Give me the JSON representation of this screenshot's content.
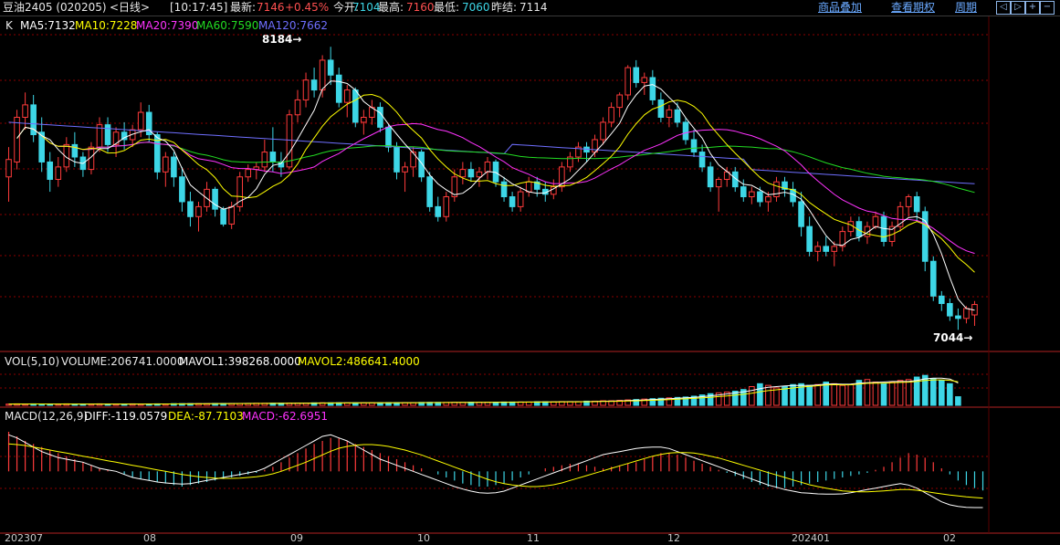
{
  "header": {
    "symbol": "豆油2405 (020205)",
    "period": "<日线>",
    "time": "[10:17:45]",
    "last_label": "最新:",
    "last_value": "7146",
    "change": "+0.45%",
    "open_label": "今开:",
    "open_value": "7104",
    "high_label": "最高:",
    "high_value": "7160",
    "low_label": "最低:",
    "low_value": "7060",
    "prev_label": "昨结:",
    "prev_value": "7114",
    "links": [
      "商品叠加",
      "查看期权",
      "周期"
    ]
  },
  "ma_legend": {
    "k": "K",
    "ma5": "MA5:7132",
    "ma10": "MA10:7228",
    "ma20": "MA20:7390",
    "ma60": "MA60:7590",
    "ma120": "MA120:7662"
  },
  "annotations": {
    "high": "8184",
    "low": "7044"
  },
  "vol_legend": {
    "name": "VOL(5,10)",
    "volume": "VOLUME:206741.0000",
    "mavol1": "MAVOL1:398268.0000",
    "mavol2": "MAVOL2:486641.4000"
  },
  "macd_legend": {
    "name": "MACD(12,26,9)",
    "diff": "DIFF:-119.0579",
    "dea": "DEA:-87.7103",
    "macd": "MACD:-62.6951"
  },
  "colors": {
    "up": "#ff3b3b",
    "down": "#3dd6e6",
    "ma5": "#ffffff",
    "ma10": "#ffff00",
    "ma20": "#ff33ff",
    "ma60": "#22dd22",
    "ma120": "#6f6fff",
    "grid": "#8b0000",
    "axis_text": "#c8c8c8",
    "up_text": "#ff5050",
    "green_text": "#22dd22",
    "cyan_text": "#3dd6e6"
  },
  "chart_data": {
    "type": "candlestick",
    "x_axis_labels": [
      "202307",
      "08",
      "09",
      "10",
      "11",
      "12",
      "202401",
      "02"
    ],
    "y_range": [
      6990,
      8240
    ],
    "candles": [
      [
        7660,
        7780,
        7560,
        7730
      ],
      [
        7720,
        7930,
        7690,
        7900
      ],
      [
        7900,
        8000,
        7850,
        7950
      ],
      [
        7950,
        7990,
        7800,
        7830
      ],
      [
        7840,
        7900,
        7680,
        7720
      ],
      [
        7720,
        7760,
        7600,
        7650
      ],
      [
        7650,
        7740,
        7620,
        7700
      ],
      [
        7700,
        7820,
        7680,
        7790
      ],
      [
        7790,
        7840,
        7700,
        7740
      ],
      [
        7740,
        7760,
        7660,
        7690
      ],
      [
        7690,
        7800,
        7670,
        7780
      ],
      [
        7780,
        7900,
        7760,
        7870
      ],
      [
        7870,
        7900,
        7760,
        7790
      ],
      [
        7790,
        7860,
        7740,
        7840
      ],
      [
        7840,
        7880,
        7770,
        7810
      ],
      [
        7810,
        7870,
        7780,
        7850
      ],
      [
        7850,
        7960,
        7820,
        7920
      ],
      [
        7920,
        7950,
        7800,
        7830
      ],
      [
        7830,
        7840,
        7650,
        7680
      ],
      [
        7680,
        7760,
        7620,
        7740
      ],
      [
        7740,
        7760,
        7620,
        7660
      ],
      [
        7660,
        7700,
        7520,
        7560
      ],
      [
        7560,
        7600,
        7460,
        7500
      ],
      [
        7500,
        7560,
        7440,
        7540
      ],
      [
        7540,
        7640,
        7520,
        7610
      ],
      [
        7610,
        7620,
        7500,
        7530
      ],
      [
        7530,
        7540,
        7460,
        7470
      ],
      [
        7470,
        7560,
        7450,
        7540
      ],
      [
        7540,
        7680,
        7520,
        7660
      ],
      [
        7660,
        7710,
        7640,
        7690
      ],
      [
        7690,
        7720,
        7650,
        7700
      ],
      [
        7700,
        7810,
        7680,
        7760
      ],
      [
        7760,
        7860,
        7680,
        7720
      ],
      [
        7720,
        7760,
        7660,
        7700
      ],
      [
        7700,
        7930,
        7690,
        7910
      ],
      [
        7910,
        8010,
        7880,
        7970
      ],
      [
        7970,
        8080,
        7940,
        8050
      ],
      [
        8050,
        8100,
        7980,
        8010
      ],
      [
        8010,
        8150,
        7980,
        8130
      ],
      [
        8130,
        8184,
        8030,
        8070
      ],
      [
        8070,
        8100,
        7940,
        7960
      ],
      [
        7960,
        8030,
        7900,
        8010
      ],
      [
        8010,
        8020,
        7860,
        7880
      ],
      [
        7880,
        7930,
        7830,
        7900
      ],
      [
        7900,
        7970,
        7870,
        7940
      ],
      [
        7940,
        7960,
        7840,
        7860
      ],
      [
        7860,
        7870,
        7760,
        7780
      ],
      [
        7780,
        7800,
        7650,
        7680
      ],
      [
        7680,
        7720,
        7600,
        7700
      ],
      [
        7700,
        7780,
        7660,
        7760
      ],
      [
        7760,
        7770,
        7640,
        7660
      ],
      [
        7660,
        7680,
        7520,
        7540
      ],
      [
        7540,
        7580,
        7480,
        7500
      ],
      [
        7500,
        7600,
        7480,
        7580
      ],
      [
        7580,
        7690,
        7560,
        7660
      ],
      [
        7660,
        7720,
        7630,
        7690
      ],
      [
        7690,
        7720,
        7640,
        7660
      ],
      [
        7660,
        7700,
        7620,
        7680
      ],
      [
        7680,
        7740,
        7650,
        7720
      ],
      [
        7720,
        7730,
        7620,
        7640
      ],
      [
        7640,
        7660,
        7560,
        7580
      ],
      [
        7580,
        7600,
        7520,
        7540
      ],
      [
        7540,
        7620,
        7520,
        7600
      ],
      [
        7600,
        7660,
        7580,
        7640
      ],
      [
        7640,
        7660,
        7580,
        7610
      ],
      [
        7610,
        7640,
        7560,
        7590
      ],
      [
        7590,
        7650,
        7570,
        7620
      ],
      [
        7620,
        7720,
        7600,
        7700
      ],
      [
        7700,
        7760,
        7680,
        7740
      ],
      [
        7740,
        7800,
        7720,
        7780
      ],
      [
        7780,
        7800,
        7720,
        7760
      ],
      [
        7760,
        7830,
        7740,
        7810
      ],
      [
        7810,
        7900,
        7790,
        7880
      ],
      [
        7880,
        7960,
        7860,
        7940
      ],
      [
        7940,
        8000,
        7900,
        7990
      ],
      [
        7990,
        8110,
        7970,
        8100
      ],
      [
        8100,
        8130,
        8020,
        8040
      ],
      [
        8040,
        8080,
        7990,
        8060
      ],
      [
        8060,
        8090,
        7950,
        7970
      ],
      [
        7970,
        8000,
        7880,
        7900
      ],
      [
        7900,
        7950,
        7860,
        7930
      ],
      [
        7930,
        7960,
        7860,
        7880
      ],
      [
        7880,
        7900,
        7790,
        7810
      ],
      [
        7810,
        7850,
        7740,
        7760
      ],
      [
        7760,
        7790,
        7680,
        7700
      ],
      [
        7700,
        7720,
        7600,
        7620
      ],
      [
        7620,
        7660,
        7520,
        7650
      ],
      [
        7650,
        7700,
        7620,
        7680
      ],
      [
        7680,
        7700,
        7600,
        7620
      ],
      [
        7620,
        7650,
        7560,
        7580
      ],
      [
        7580,
        7620,
        7550,
        7600
      ],
      [
        7600,
        7620,
        7540,
        7560
      ],
      [
        7560,
        7600,
        7520,
        7580
      ],
      [
        7580,
        7660,
        7560,
        7640
      ],
      [
        7640,
        7660,
        7580,
        7610
      ],
      [
        7610,
        7640,
        7540,
        7560
      ],
      [
        7560,
        7600,
        7420,
        7460
      ],
      [
        7460,
        7500,
        7340,
        7360
      ],
      [
        7360,
        7400,
        7320,
        7380
      ],
      [
        7380,
        7420,
        7340,
        7360
      ],
      [
        7360,
        7400,
        7300,
        7380
      ],
      [
        7380,
        7460,
        7360,
        7440
      ],
      [
        7440,
        7500,
        7420,
        7480
      ],
      [
        7480,
        7500,
        7400,
        7420
      ],
      [
        7420,
        7480,
        7390,
        7460
      ],
      [
        7460,
        7520,
        7450,
        7500
      ],
      [
        7500,
        7520,
        7380,
        7400
      ],
      [
        7400,
        7480,
        7380,
        7460
      ],
      [
        7460,
        7560,
        7440,
        7540
      ],
      [
        7540,
        7590,
        7500,
        7580
      ],
      [
        7580,
        7600,
        7480,
        7520
      ],
      [
        7520,
        7540,
        7280,
        7320
      ],
      [
        7320,
        7340,
        7160,
        7180
      ],
      [
        7180,
        7200,
        7120,
        7150
      ],
      [
        7150,
        7170,
        7080,
        7100
      ],
      [
        7100,
        7130,
        7044,
        7090
      ],
      [
        7090,
        7140,
        7070,
        7130
      ],
      [
        7104,
        7160,
        7060,
        7146
      ]
    ],
    "vol_y_range": [
      0,
      900000
    ],
    "volume": [
      30000,
      35000,
      30000,
      35000,
      30000,
      30000,
      30000,
      35000,
      30000,
      30000,
      30000,
      35000,
      30000,
      30000,
      30000,
      35000,
      30000,
      30000,
      35000,
      30000,
      40000,
      40000,
      40000,
      40000,
      40000,
      45000,
      45000,
      45000,
      45000,
      45000,
      50000,
      50000,
      50000,
      50000,
      55000,
      55000,
      55000,
      60000,
      60000,
      60000,
      60000,
      60000,
      60000,
      60000,
      60000,
      60000,
      65000,
      65000,
      65000,
      65000,
      70000,
      70000,
      70000,
      70000,
      70000,
      70000,
      75000,
      75000,
      75000,
      75000,
      80000,
      80000,
      80000,
      80000,
      85000,
      85000,
      85000,
      90000,
      90000,
      90000,
      100000,
      100000,
      110000,
      110000,
      120000,
      130000,
      140000,
      150000,
      160000,
      170000,
      180000,
      190000,
      200000,
      220000,
      250000,
      280000,
      300000,
      320000,
      340000,
      380000,
      450000,
      520000,
      480000,
      420000,
      460000,
      500000,
      520000,
      480000,
      500000,
      560000,
      520000,
      480000,
      500000,
      600000,
      620000,
      560000,
      520000,
      560000,
      600000,
      620000,
      680000,
      720000,
      640000,
      600000,
      520000,
      206741
    ],
    "macd_y_range": [
      -200,
      160
    ],
    "macd_hist": [
      130,
      115,
      100,
      90,
      80,
      70,
      60,
      50,
      40,
      30,
      20,
      10,
      5,
      0,
      -10,
      -20,
      -25,
      -30,
      -35,
      -40,
      -45,
      -50,
      -45,
      -40,
      -35,
      -30,
      -25,
      -20,
      -15,
      -10,
      -5,
      5,
      15,
      30,
      45,
      60,
      75,
      90,
      100,
      110,
      110,
      100,
      90,
      80,
      70,
      60,
      50,
      40,
      30,
      20,
      10,
      0,
      -10,
      -20,
      -30,
      -40,
      -45,
      -50,
      -50,
      -45,
      -40,
      -30,
      -20,
      -10,
      0,
      10,
      15,
      20,
      25,
      25,
      20,
      15,
      10,
      15,
      20,
      25,
      30,
      40,
      50,
      60,
      60,
      55,
      45,
      35,
      25,
      15,
      5,
      -5,
      -15,
      -25,
      -35,
      -45,
      -50,
      -55,
      -55,
      -50,
      -45,
      -40,
      -35,
      -30,
      -25,
      -20,
      -15,
      -10,
      -5,
      5,
      15,
      30,
      45,
      60,
      55,
      45,
      30,
      10,
      -10,
      -30,
      -45,
      -55,
      -62.6951
    ],
    "macd_diff": [
      120,
      110,
      95,
      80,
      65,
      55,
      45,
      40,
      35,
      30,
      20,
      10,
      5,
      0,
      -10,
      -20,
      -25,
      -30,
      -35,
      -38,
      -40,
      -42,
      -40,
      -35,
      -30,
      -25,
      -20,
      -15,
      -10,
      -5,
      0,
      10,
      25,
      40,
      55,
      70,
      85,
      100,
      115,
      120,
      110,
      100,
      85,
      70,
      55,
      40,
      30,
      20,
      10,
      0,
      -10,
      -20,
      -30,
      -40,
      -50,
      -58,
      -65,
      -70,
      -72,
      -70,
      -65,
      -55,
      -45,
      -35,
      -25,
      -15,
      -5,
      5,
      15,
      25,
      35,
      45,
      55,
      60,
      65,
      70,
      75,
      78,
      80,
      80,
      75,
      65,
      55,
      45,
      35,
      25,
      15,
      5,
      -5,
      -15,
      -25,
      -35,
      -45,
      -52,
      -60,
      -65,
      -70,
      -72,
      -74,
      -75,
      -75,
      -74,
      -70,
      -65,
      -60,
      -55,
      -50,
      -45,
      -40,
      -45,
      -55,
      -70,
      -85,
      -100,
      -110,
      -115,
      -118,
      -119,
      -119.0579
    ],
    "macd_dea": [
      90,
      88,
      85,
      80,
      75,
      70,
      65,
      60,
      55,
      50,
      45,
      40,
      35,
      30,
      25,
      20,
      15,
      10,
      5,
      0,
      -5,
      -10,
      -14,
      -18,
      -20,
      -22,
      -23,
      -23,
      -22,
      -20,
      -18,
      -14,
      -8,
      0,
      10,
      20,
      30,
      42,
      54,
      66,
      76,
      82,
      86,
      88,
      88,
      86,
      82,
      76,
      70,
      62,
      54,
      44,
      34,
      24,
      14,
      4,
      -6,
      -16,
      -26,
      -34,
      -40,
      -45,
      -48,
      -50,
      -50,
      -48,
      -44,
      -38,
      -30,
      -22,
      -14,
      -6,
      2,
      10,
      18,
      26,
      34,
      42,
      50,
      56,
      60,
      62,
      62,
      60,
      56,
      50,
      44,
      36,
      28,
      20,
      12,
      4,
      -4,
      -12,
      -20,
      -28,
      -36,
      -44,
      -50,
      -55,
      -60,
      -64,
      -66,
      -67,
      -67,
      -66,
      -64,
      -62,
      -60,
      -60,
      -62,
      -66,
      -70,
      -74,
      -78,
      -81,
      -84,
      -86,
      -87.7103
    ]
  }
}
